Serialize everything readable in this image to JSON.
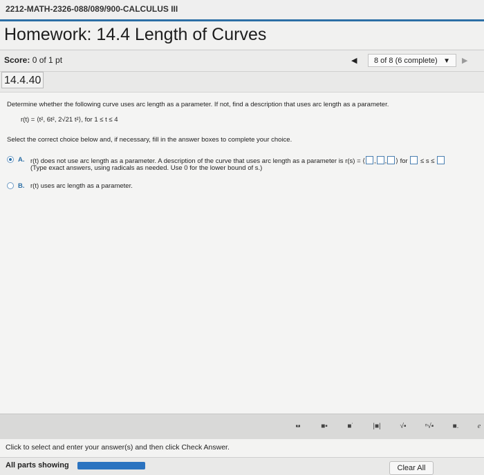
{
  "course": {
    "title": "2212-MATH-2326-088/089/900-CALCULUS III"
  },
  "homework": {
    "title": "Homework: 14.4 Length of Curves"
  },
  "score": {
    "label": "Score:",
    "value": "0 of 1 pt"
  },
  "navigation": {
    "progress_text": "8 of 8 (6 complete)",
    "prev_icon": "triangle-left",
    "next_icon": "triangle-right"
  },
  "question": {
    "number": "14.4.40",
    "prompt": "Determine whether the following curve uses arc length as a parameter. If not, find a description that uses arc length as a parameter.",
    "formula": "r(t) = ⟨t², 6t², 2√21 t²⟩, for 1 ≤ t ≤ 4",
    "instructions": "Select the correct choice below and, if necessary, fill in the answer boxes to complete your choice."
  },
  "choices": [
    {
      "letter": "A.",
      "selected": true,
      "text_prefix": "r(t) does not use arc length as a parameter. A description of the curve that uses arc length as a parameter is r(s) =",
      "text_for": "for",
      "text_leq": "≤ s ≤",
      "subtext": "(Type exact answers, using radicals as needed. Use 0 for the lower bound of s.)"
    },
    {
      "letter": "B.",
      "selected": false,
      "text": "r(t) uses arc length as a parameter."
    }
  ],
  "toolbar": {
    "buttons": [
      "fraction-icon",
      "mixed-number-icon",
      "exponent-icon",
      "absolute-value-icon",
      "sqrt-icon",
      "nth-root-icon",
      "decimal-icon",
      "e-icon"
    ]
  },
  "footer": {
    "instruction": "Click to select and enter your answer(s) and then click Check Answer.",
    "all_parts": "All parts showing",
    "clear_all": "Clear All"
  },
  "colors": {
    "accent": "#2c6fa6",
    "progress_bar": "#2b73c0"
  }
}
